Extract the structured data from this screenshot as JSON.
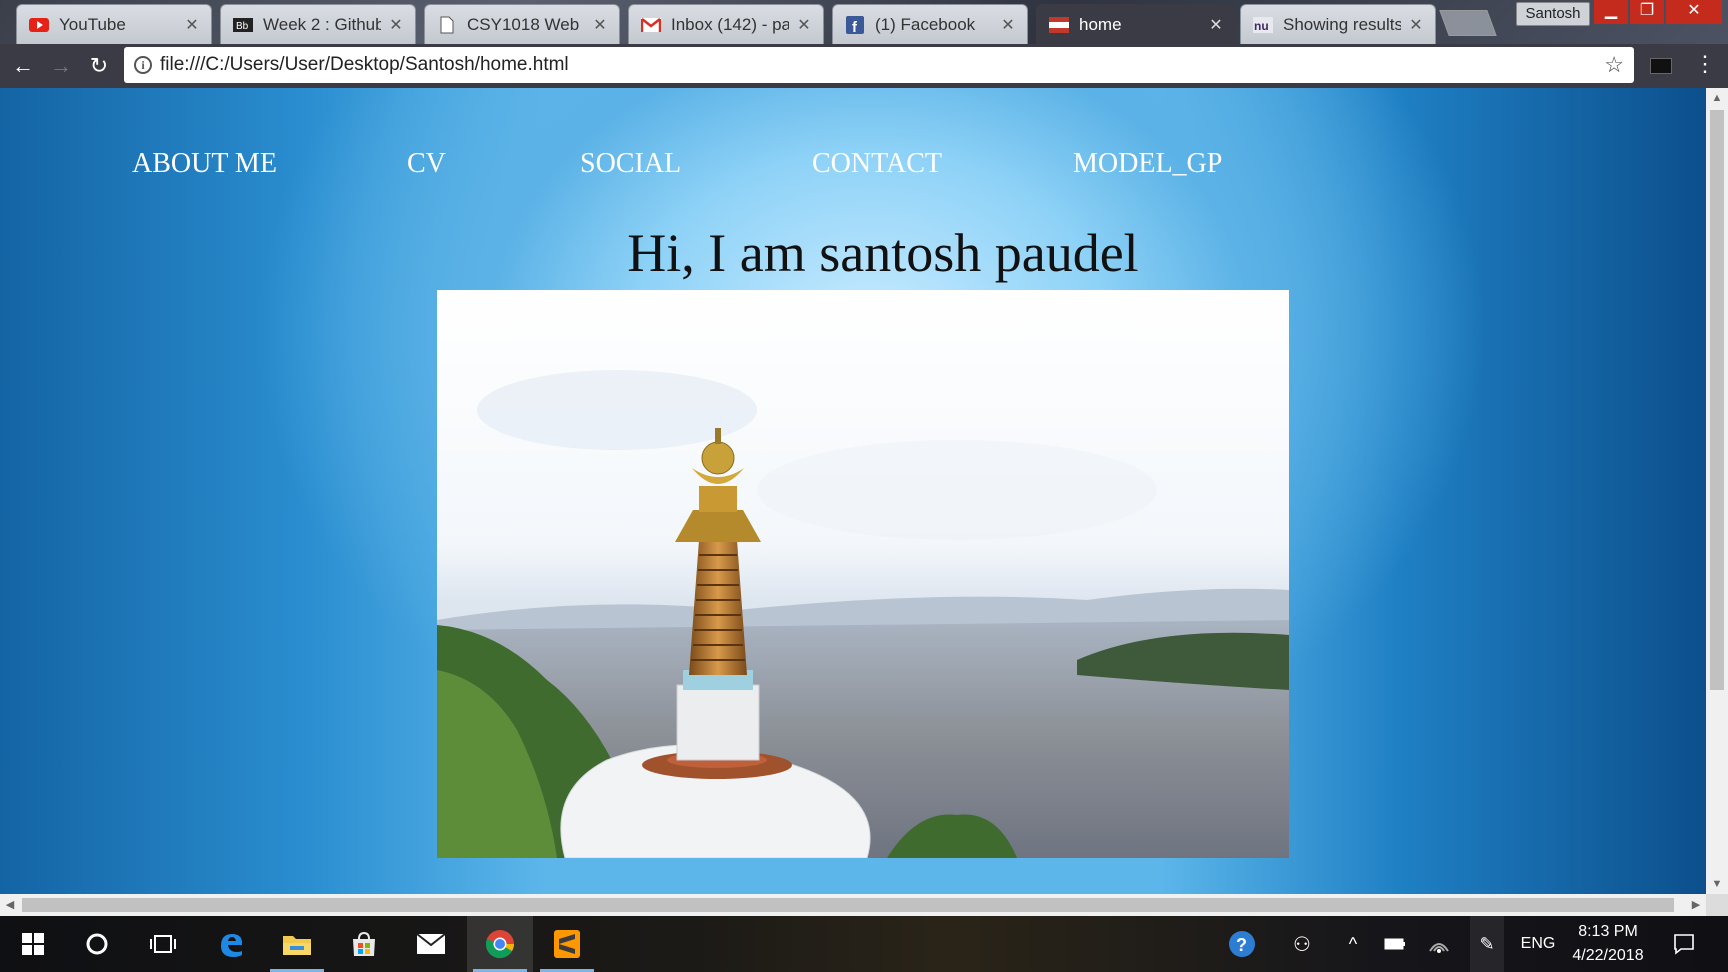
{
  "browser": {
    "tabs": [
      {
        "label": "YouTube",
        "icon": "youtube-icon",
        "active": false
      },
      {
        "label": "Week 2 : Github",
        "icon": "blackboard-icon",
        "active": false
      },
      {
        "label": "CSY1018 Web D",
        "icon": "document-icon",
        "active": false
      },
      {
        "label": "Inbox (142) - pa",
        "icon": "gmail-icon",
        "active": false
      },
      {
        "label": "(1) Facebook",
        "icon": "facebook-icon",
        "active": false
      },
      {
        "label": "home",
        "icon": "page-flag-icon",
        "active": true
      },
      {
        "label": "Showing results",
        "icon": "nu-icon",
        "active": false
      }
    ],
    "profile_name": "Santosh",
    "url": "file:///C:/Users/User/Desktop/Santosh/home.html"
  },
  "page": {
    "nav": [
      "ABOUT ME",
      "CV",
      "SOCIAL",
      "CONTACT",
      "MODEL_GP"
    ],
    "heading": "Hi, I am santosh paudel",
    "photo": {
      "subject": "stupa-over-city-valley-photo"
    }
  },
  "taskbar": {
    "apps": [
      "start-icon",
      "cortana-icon",
      "task-view-icon",
      "edge-icon",
      "file-explorer-icon",
      "store-icon",
      "mail-icon",
      "chrome-icon",
      "sublime-icon"
    ],
    "tray": {
      "language": "ENG",
      "time": "8:13 PM",
      "date": "4/22/2018"
    }
  },
  "colors": {
    "page_center": "#c8ebff",
    "page_edge": "#0c4f8c",
    "nav_text": "#ffffff",
    "heading_text": "#111111",
    "toolbar": "#3b3b46"
  }
}
